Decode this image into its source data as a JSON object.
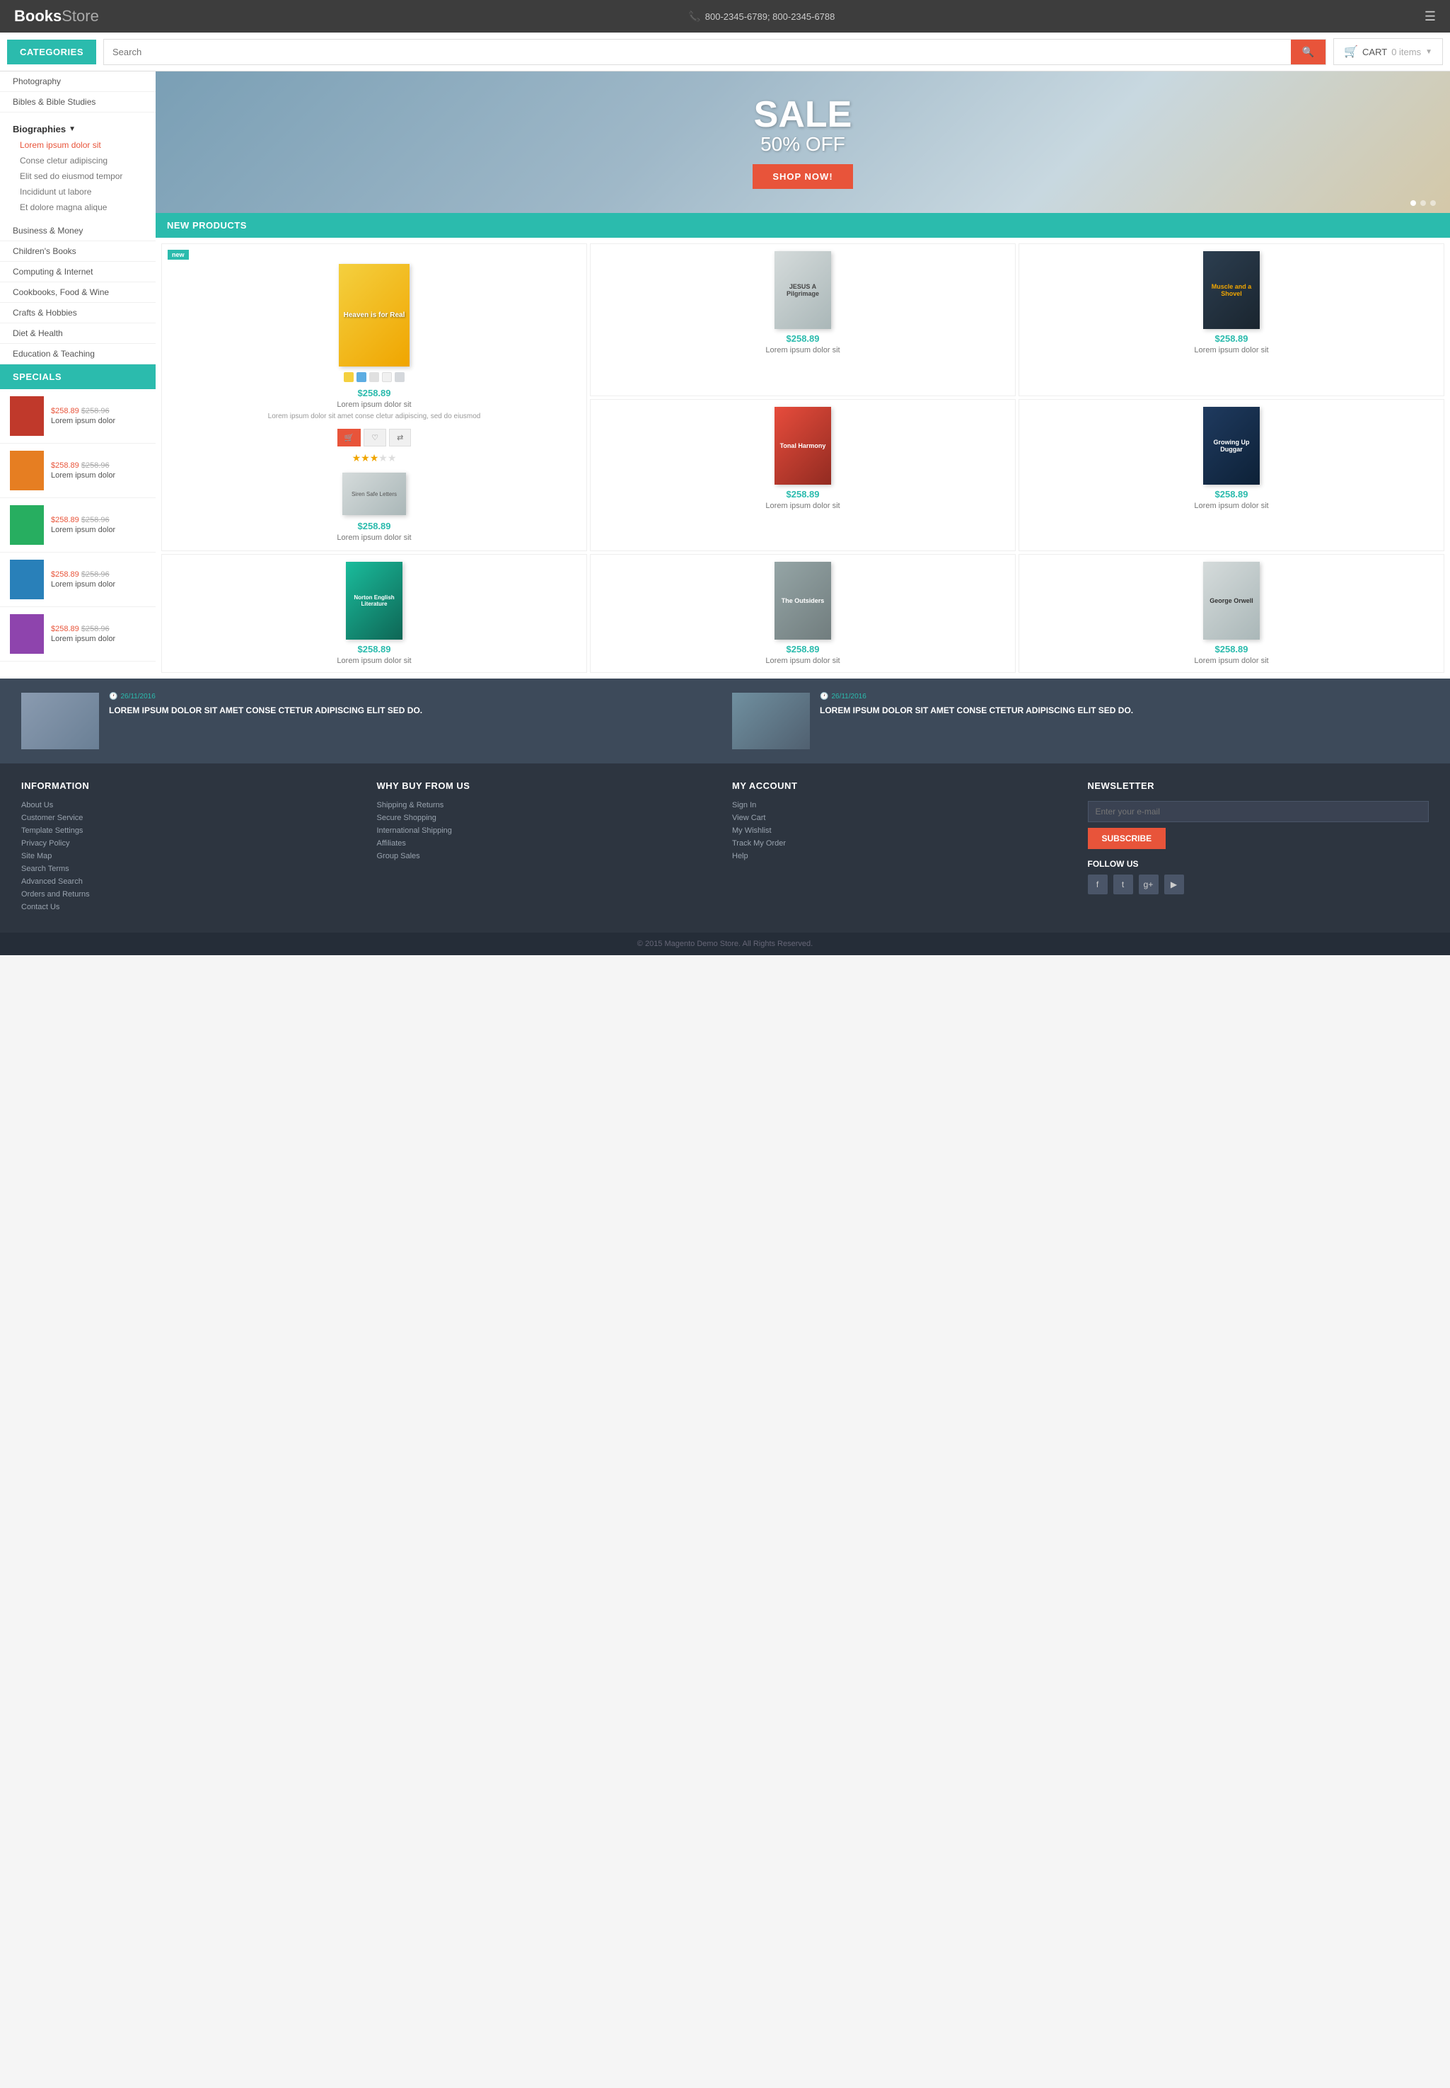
{
  "header": {
    "logo_bold": "Books",
    "logo_light": "Store",
    "phone": "800-2345-6789; 800-2345-6788",
    "search_placeholder": "Search",
    "cart_label": "CART",
    "cart_items": "0 items",
    "categories_label": "CATEGORIES"
  },
  "sidebar": {
    "categories": [
      {
        "label": "Photography"
      },
      {
        "label": "Bibles & Bible Studies"
      },
      {
        "label": "Biographies",
        "has_children": true
      },
      {
        "label": "Lorem ipsum dolor sit",
        "active": true
      },
      {
        "label": "Conse cletur adipiscing"
      },
      {
        "label": "Elit sed do eiusmod tempor"
      },
      {
        "label": "Incididunt ut labore"
      },
      {
        "label": "Et dolore magna alique"
      },
      {
        "label": "Business & Money"
      },
      {
        "label": "Children's Books"
      },
      {
        "label": "Computing & Internet"
      },
      {
        "label": "Cookbooks, Food & Wine"
      },
      {
        "label": "Crafts & Hobbies"
      },
      {
        "label": "Diet & Health"
      },
      {
        "label": "Education & Teaching"
      }
    ],
    "specials_label": "SPECIALS",
    "specials": [
      {
        "price_new": "$258.89",
        "price_old": "$258.96",
        "name": "Lorem ipsum dolor",
        "color": "sc1"
      },
      {
        "price_new": "$258.89",
        "price_old": "$258.96",
        "name": "Lorem ipsum dolor",
        "color": "sc2"
      },
      {
        "price_new": "$258.89",
        "price_old": "$258.96",
        "name": "Lorem ipsum dolor",
        "color": "sc3"
      },
      {
        "price_new": "$258.89",
        "price_old": "$258.96",
        "name": "Lorem ipsum dolor",
        "color": "sc4"
      },
      {
        "price_new": "$258.89",
        "price_old": "$258.96",
        "name": "Lorem ipsum dolor",
        "color": "sc5"
      }
    ]
  },
  "hero": {
    "sale_text": "SALE",
    "off_text": "50% OFF",
    "btn_label": "SHOP NOW!"
  },
  "new_products": {
    "section_label": "NEW PRODUCTS",
    "featured": {
      "badge": "new",
      "price": "$258.89",
      "name": "Lorem ipsum dolor sit",
      "desc": "Lorem ipsum dolor sit amet conse cletur adipiscing, sed do eiusmod",
      "book_label": "Heaven is for Real",
      "color": "bc-yellow",
      "stars": 3
    },
    "products": [
      {
        "price": "$258.89",
        "name": "Lorem ipsum dolor sit",
        "book_label": "JESUS A Pilgrimage",
        "color": "bc-light"
      },
      {
        "price": "$258.89",
        "name": "Lorem ipsum dolor sit",
        "book_label": "Muscle and a Shovel",
        "color": "bc-dark"
      },
      {
        "price": "$258.89",
        "name": "Lorem ipsum dolor sit",
        "book_label": "Tonal Harmony",
        "color": "bc-red"
      },
      {
        "price": "$258.89",
        "name": "Lorem ipsum dolor sit",
        "book_label": "Growing Up Duggar",
        "color": "bc-navy"
      },
      {
        "price": "$258.89",
        "name": "Lorem ipsum dolor sit",
        "book_label": "Norton English Literature",
        "color": "bc-teal"
      },
      {
        "price": "$258.89",
        "name": "Lorem ipsum dolor sit",
        "book_label": "The Outsiders",
        "color": "bc-gray"
      },
      {
        "price": "$258.89",
        "name": "Lorem ipsum dolor sit",
        "book_label": "George Orwell",
        "color": "bc-light"
      }
    ]
  },
  "blog": {
    "items": [
      {
        "date": "26/11/2016",
        "title": "LOREM IPSUM DOLOR SIT AMET CONSE CTETUR ADIPISCING ELIT SED DO."
      },
      {
        "date": "26/11/2016",
        "title": "LOREM IPSUM DOLOR SIT AMET CONSE CTETUR ADIPISCING ELIT SED DO."
      }
    ]
  },
  "footer": {
    "information": {
      "title": "INFORMATION",
      "links": [
        "About Us",
        "Customer Service",
        "Template Settings",
        "Privacy Policy",
        "Site Map",
        "Search Terms",
        "Advanced Search",
        "Orders and Returns",
        "Contact Us"
      ]
    },
    "why_buy": {
      "title": "WHY BUY FROM US",
      "links": [
        "Shipping & Returns",
        "Secure Shopping",
        "International Shipping",
        "Affiliates",
        "Group Sales"
      ]
    },
    "my_account": {
      "title": "MY ACCOUNT",
      "links": [
        "Sign In",
        "View Cart",
        "My Wishlist",
        "Track My Order",
        "Help"
      ]
    },
    "newsletter": {
      "title": "NEWSLETTER",
      "placeholder": "Enter your e-mail",
      "subscribe_label": "SUBSCRIBE",
      "follow_label": "FOLLOW US"
    },
    "copyright": "© 2015 Magento Demo Store. All Rights Reserved."
  }
}
